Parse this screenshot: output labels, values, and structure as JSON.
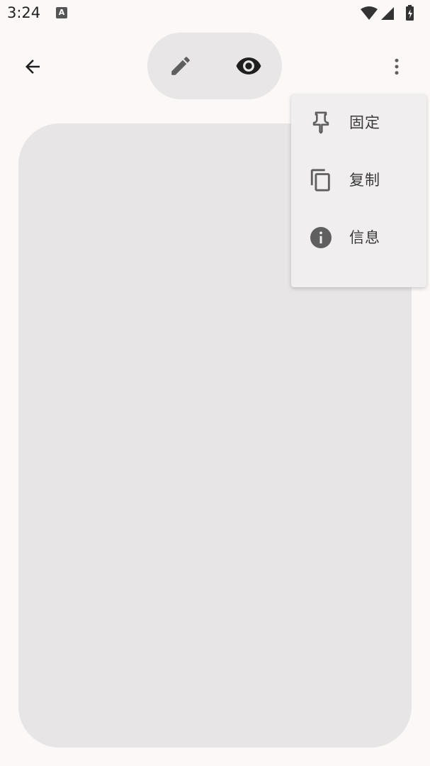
{
  "status_bar": {
    "time": "3:24",
    "notification_icon": "text-a-icon",
    "icons": [
      "wifi-icon",
      "signal-icon",
      "battery-charging-icon"
    ]
  },
  "toolbar": {
    "back_icon": "arrow-back-icon",
    "mode_toggle": {
      "edit_icon": "pencil-icon",
      "preview_icon": "eye-icon"
    },
    "more_icon": "more-vert-icon"
  },
  "menu": {
    "items": [
      {
        "label": "固定",
        "icon": "pin-icon"
      },
      {
        "label": "复制",
        "icon": "copy-icon"
      },
      {
        "label": "信息",
        "icon": "info-icon"
      }
    ]
  },
  "colors": {
    "background": "#fcf8f8",
    "card": "#e7e5e6",
    "toggle": "#e8e6e6",
    "menu": "#f0eeee",
    "icon": "#5f5f5f"
  }
}
